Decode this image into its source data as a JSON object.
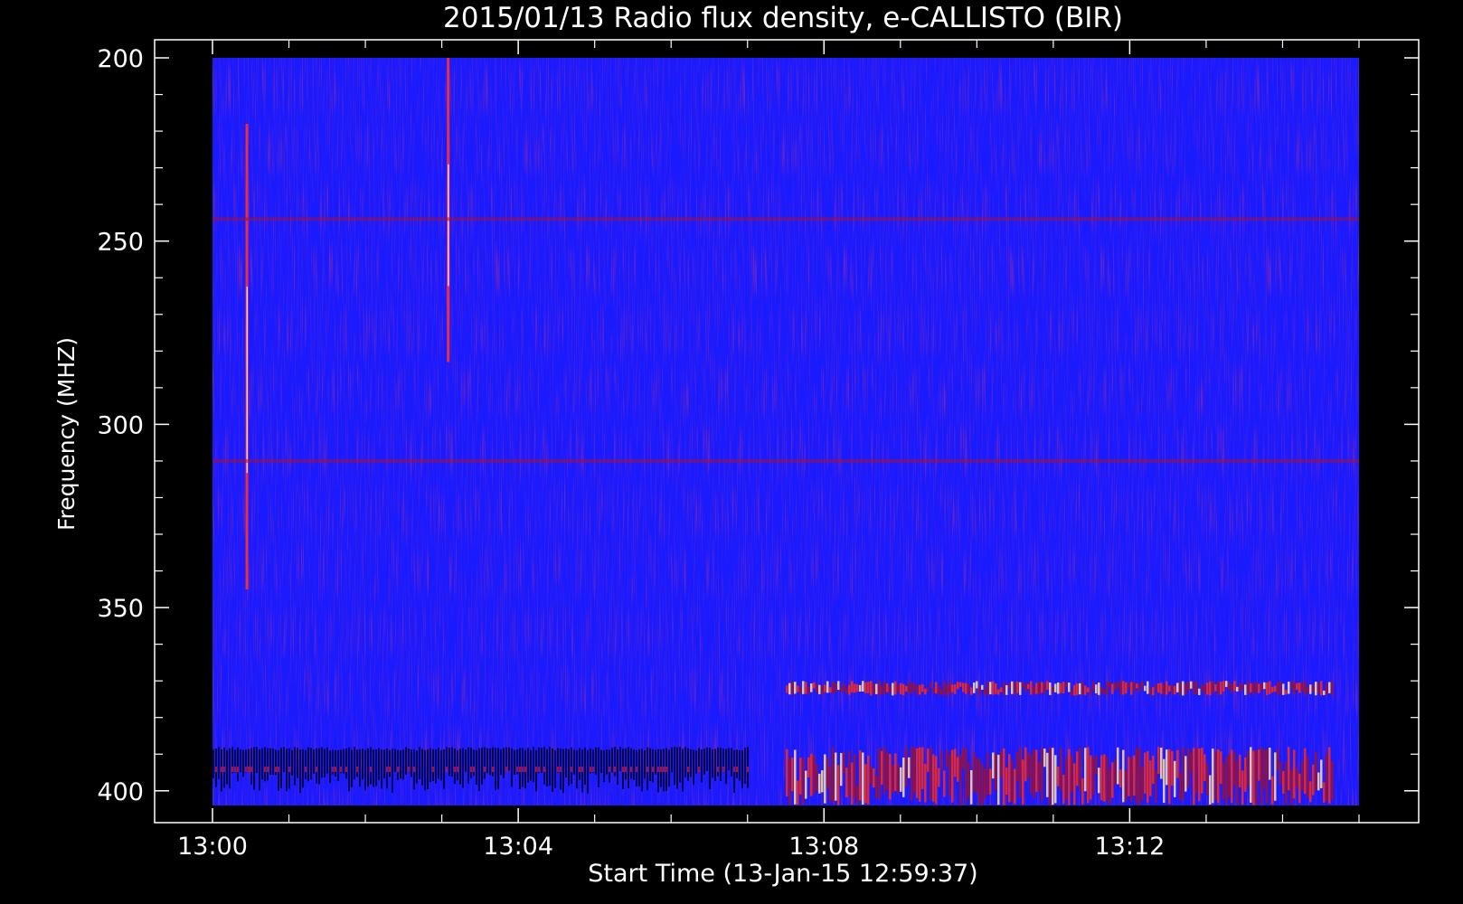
{
  "chart_data": {
    "type": "heatmap",
    "title": "2015/01/13  Radio flux density, e-CALLISTO (BIR)",
    "xlabel": "Start Time (13-Jan-15 12:59:37)",
    "ylabel": "Frequency (MHZ)",
    "x_ticks": [
      "13:00",
      "13:04",
      "13:08",
      "13:12"
    ],
    "y_ticks": [
      "200",
      "250",
      "300",
      "350",
      "400"
    ],
    "xlim_minutes_after_1300": [
      0,
      15
    ],
    "ylim_mhz": [
      200,
      404
    ],
    "y_inverted": true,
    "grid": false,
    "colormap": [
      "#000000",
      "#1818ff",
      "#ff1010",
      "#ffffff"
    ],
    "features": [
      {
        "kind": "burst",
        "time": "13:00:27",
        "freq_mhz": [
          218,
          345
        ]
      },
      {
        "kind": "burst",
        "time": "13:03:05",
        "freq_mhz": [
          200,
          283
        ]
      },
      {
        "kind": "emission_band",
        "time": [
          "13:07:30",
          "13:14:40"
        ],
        "freq_mhz": [
          370,
          374
        ]
      },
      {
        "kind": "emission_band",
        "time": [
          "13:07:30",
          "13:14:40"
        ],
        "freq_mhz": [
          388,
          404
        ]
      },
      {
        "kind": "absorption_band",
        "time": [
          "13:00:00",
          "13:07:00"
        ],
        "freq_mhz": [
          388,
          400
        ]
      },
      {
        "kind": "interference_line",
        "freq_mhz": 244
      },
      {
        "kind": "interference_line",
        "freq_mhz": 310
      }
    ]
  }
}
